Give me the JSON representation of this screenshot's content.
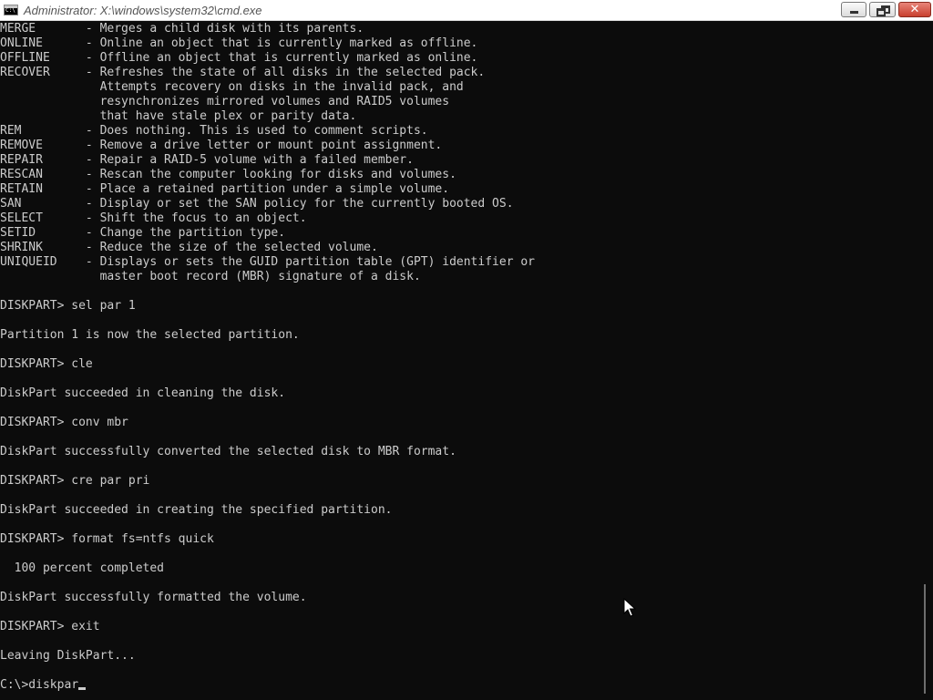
{
  "window": {
    "title": "Administrator: X:\\windows\\system32\\cmd.exe",
    "icon": "cmd-icon",
    "controls": {
      "minimize_icon": "minimize-icon",
      "maximize_icon": "restore-icon",
      "close_glyph": "✕"
    }
  },
  "console": {
    "colors": {
      "background": "#0c0c0c",
      "text": "#cccccc"
    },
    "lines": [
      "MERGE       - Merges a child disk with its parents.",
      "ONLINE      - Online an object that is currently marked as offline.",
      "OFFLINE     - Offline an object that is currently marked as online.",
      "RECOVER     - Refreshes the state of all disks in the selected pack.",
      "              Attempts recovery on disks in the invalid pack, and",
      "              resynchronizes mirrored volumes and RAID5 volumes",
      "              that have stale plex or parity data.",
      "REM         - Does nothing. This is used to comment scripts.",
      "REMOVE      - Remove a drive letter or mount point assignment.",
      "REPAIR      - Repair a RAID-5 volume with a failed member.",
      "RESCAN      - Rescan the computer looking for disks and volumes.",
      "RETAIN      - Place a retained partition under a simple volume.",
      "SAN         - Display or set the SAN policy for the currently booted OS.",
      "SELECT      - Shift the focus to an object.",
      "SETID       - Change the partition type.",
      "SHRINK      - Reduce the size of the selected volume.",
      "UNIQUEID    - Displays or sets the GUID partition table (GPT) identifier or",
      "              master boot record (MBR) signature of a disk.",
      "",
      "DISKPART> sel par 1",
      "",
      "Partition 1 is now the selected partition.",
      "",
      "DISKPART> cle",
      "",
      "DiskPart succeeded in cleaning the disk.",
      "",
      "DISKPART> conv mbr",
      "",
      "DiskPart successfully converted the selected disk to MBR format.",
      "",
      "DISKPART> cre par pri",
      "",
      "DiskPart succeeded in creating the specified partition.",
      "",
      "DISKPART> format fs=ntfs quick",
      "",
      "  100 percent completed",
      "",
      "DiskPart successfully formatted the volume.",
      "",
      "DISKPART> exit",
      "",
      "Leaving DiskPart...",
      ""
    ],
    "prompt_line": "C:\\>diskpar"
  },
  "scrollbar": {
    "position_fraction": 1.0
  },
  "pointer_icon": "mouse-pointer-icon"
}
